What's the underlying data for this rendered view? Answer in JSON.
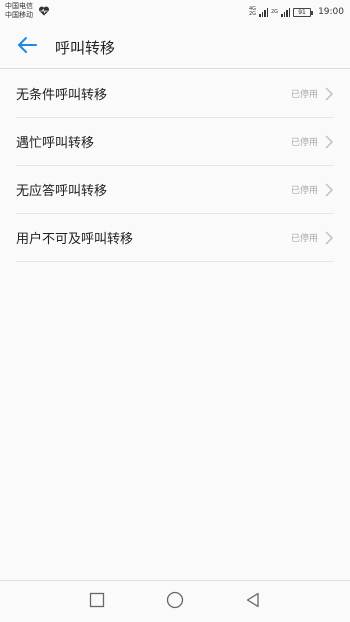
{
  "status_bar": {
    "carrier_1": "中国电信",
    "carrier_2": "中国移动",
    "net_tag_1a": "4G",
    "net_tag_1b": "2G",
    "net_tag_2": "2G",
    "battery": "91",
    "time": "19:00"
  },
  "header": {
    "title": "呼叫转移"
  },
  "list": {
    "items": [
      {
        "label": "无条件呼叫转移",
        "status": "已停用"
      },
      {
        "label": "遇忙呼叫转移",
        "status": "已停用"
      },
      {
        "label": "无应答呼叫转移",
        "status": "已停用"
      },
      {
        "label": "用户不可及呼叫转移",
        "status": "已停用"
      }
    ]
  },
  "colors": {
    "accent": "#1e88e5",
    "text": "#222222",
    "muted": "#aaaaaa",
    "background": "#fafafa"
  },
  "icons": {
    "back": "arrow-left-icon",
    "chevron": "chevron-right-icon",
    "nav_recent": "square-icon",
    "nav_home": "circle-icon",
    "nav_back": "triangle-back-icon"
  }
}
